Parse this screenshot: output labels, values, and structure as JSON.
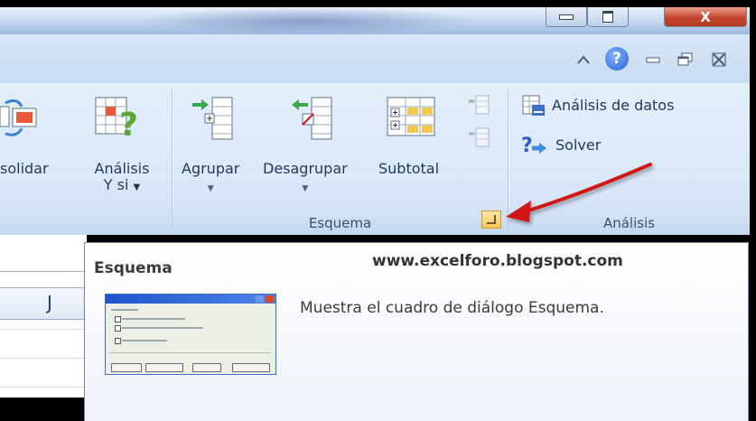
{
  "window": {
    "minimize_glyph": "▁",
    "restore_glyph": "□",
    "close_glyph": "X"
  },
  "ribbon_controls": {
    "help_glyph": "?",
    "collapse_glyph": "⌂"
  },
  "groups": {
    "datos_tools": {
      "consolidar_label": "solidar",
      "analisis_label_line1": "Análisis",
      "analisis_label_line2": "Y si"
    },
    "esquema": {
      "label": "Esquema",
      "agrupar_label": "Agrupar",
      "desagrupar_label": "Desagrupar",
      "subtotal_label": "Subtotal"
    },
    "analisis": {
      "label": "Análisis",
      "analisis_datos_label": "Análisis de datos",
      "solver_label": "Solver"
    }
  },
  "sheet": {
    "column_header": "J"
  },
  "tooltip": {
    "title": "Esquema",
    "url": "www.excelforo.blogspot.com",
    "description": "Muestra el cuadro de diálogo Esquema."
  },
  "colors": {
    "ribbon_bg": "#dbe8f8",
    "annotation_arrow": "#d01818",
    "launcher": "#f6c55a",
    "close_button": "#c8452f"
  }
}
